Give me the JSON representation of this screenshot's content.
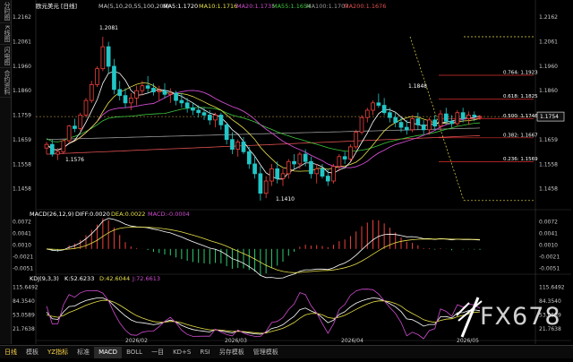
{
  "sidebar": {
    "tabs": [
      {
        "label": "分时图"
      },
      {
        "label": "K线图"
      },
      {
        "label": "闪电图"
      },
      {
        "label": "合约资料"
      }
    ]
  },
  "main_legend": {
    "symbol": "欧元美元",
    "period": "[日线]",
    "ma_params": "MA(5,10,20,55,100,200)",
    "ma5": "MA5:1.1720",
    "ma10": "MA10:1.1716",
    "ma20": "MA20:1.1735",
    "ma55": "MA55:1.1654",
    "ma100": "MA100:1.1707",
    "ma200": "MA200:1.1676"
  },
  "price_axis": {
    "left": [
      "1.2162",
      "1.2061",
      "1.1960",
      "1.1860",
      "1.1759",
      "1.1659",
      "1.1558",
      "1.1458"
    ],
    "right": [
      "1.2162",
      "1.2061",
      "1.1960",
      "1.1860",
      "1.1759",
      "1.1659",
      "1.1558",
      "1.1458"
    ],
    "current_price": "1.1754"
  },
  "annotations": {
    "high": "1.2081",
    "low1": "1.1576",
    "low2": "1.1410",
    "peak": "1.1848"
  },
  "fib_levels": [
    {
      "label": "0.764: 1.1923",
      "value": 1.1923
    },
    {
      "label": "0.618: 1.1825",
      "value": 1.1825
    },
    {
      "label": "0.500: 1.1746",
      "value": 1.1746
    },
    {
      "label": "0.382: 1.1667",
      "value": 1.1667
    },
    {
      "label": "0.236: 1.1569",
      "value": 1.1569
    }
  ],
  "macd_legend": {
    "params": "MACD(26,12,9)",
    "diff": "DIFF:0.0020",
    "dea": "DEA:0.0022",
    "macd": "MACD:-0.0004"
  },
  "macd_axis": {
    "left": [
      "0.0072",
      "0.0041",
      "0.0010",
      "-0.0021",
      "-0.0051"
    ],
    "right": [
      "0.0072",
      "0.0041",
      "0.0010",
      "-0.0021",
      "-0.0051"
    ]
  },
  "kdj_legend": {
    "params": "KDJ(9,3,3)",
    "k": "K:52.6233",
    "d": "D:42.6044",
    "j": "J:72.6613"
  },
  "kdj_axis": {
    "left": [
      "115.6492",
      "84.3540",
      "53.0589",
      "21.7638"
    ],
    "right": [
      "115.6492",
      "84.3540",
      "53.0589",
      "21.7638"
    ]
  },
  "x_axis": {
    "labels": [
      "2026/02",
      "2026/03",
      "2026/04",
      "2026/05"
    ]
  },
  "bottom_tabs": [
    {
      "label": "日线"
    },
    {
      "label": "模板"
    },
    {
      "label": "YZ指标"
    },
    {
      "label": "标准"
    },
    {
      "label": "MACD"
    },
    {
      "label": "BOLL"
    },
    {
      "label": "一目"
    },
    {
      "label": "KD+S"
    },
    {
      "label": "RSI"
    },
    {
      "label": "另存模板"
    },
    {
      "label": "管理模板"
    }
  ],
  "watermark": {
    "text": "FX678"
  },
  "colors": {
    "up": "#f0413c",
    "down": "#22c6c6",
    "ma5": "#ffffff",
    "ma10": "#e8e04a",
    "ma20": "#d04cd0",
    "ma55": "#3dc93d",
    "ma100": "#9a9a9a",
    "ma200": "#e05050",
    "fib": "#e03030",
    "trend": "#e8e04a",
    "background": "#000000",
    "brand": "#ffd54a"
  },
  "chart_data": {
    "type": "candlestick",
    "symbol": "欧元美元",
    "period": "日线",
    "ylim": [
      1.138,
      1.218
    ],
    "x": [
      "2026/01/14",
      "2026/01/15",
      "2026/01/16",
      "2026/01/19",
      "2026/01/20",
      "2026/01/21",
      "2026/01/22",
      "2026/01/23",
      "2026/01/26",
      "2026/01/27",
      "2026/01/28",
      "2026/01/29",
      "2026/01/30",
      "2026/02/02",
      "2026/02/03",
      "2026/02/04",
      "2026/02/05",
      "2026/02/06",
      "2026/02/09",
      "2026/02/10",
      "2026/02/11",
      "2026/02/12",
      "2026/02/13",
      "2026/02/16",
      "2026/02/17",
      "2026/02/18",
      "2026/02/19",
      "2026/02/20",
      "2026/02/23",
      "2026/02/24",
      "2026/02/25",
      "2026/02/26",
      "2026/02/27",
      "2026/03/02",
      "2026/03/03",
      "2026/03/04",
      "2026/03/05",
      "2026/03/06",
      "2026/03/09",
      "2026/03/10",
      "2026/03/11",
      "2026/03/12",
      "2026/03/13",
      "2026/03/16",
      "2026/03/17",
      "2026/03/18",
      "2026/03/19",
      "2026/03/20",
      "2026/03/23",
      "2026/03/24",
      "2026/03/25",
      "2026/03/26",
      "2026/03/27",
      "2026/03/30",
      "2026/03/31",
      "2026/04/01",
      "2026/04/02",
      "2026/04/03",
      "2026/04/06",
      "2026/04/07",
      "2026/04/08",
      "2026/04/09",
      "2026/04/10",
      "2026/04/13",
      "2026/04/14",
      "2026/04/15",
      "2026/04/16",
      "2026/04/17",
      "2026/04/20",
      "2026/04/21",
      "2026/04/22",
      "2026/04/23",
      "2026/04/24",
      "2026/04/27",
      "2026/04/28",
      "2026/04/29",
      "2026/04/30",
      "2026/05/01"
    ],
    "ohlc": [
      [
        1.1625,
        1.165,
        1.16,
        1.164
      ],
      [
        1.164,
        1.166,
        1.159,
        1.16
      ],
      [
        1.16,
        1.1625,
        1.1576,
        1.161
      ],
      [
        1.161,
        1.166,
        1.16,
        1.1655
      ],
      [
        1.1655,
        1.172,
        1.1645,
        1.1715
      ],
      [
        1.1715,
        1.1745,
        1.169,
        1.1705
      ],
      [
        1.1705,
        1.177,
        1.1695,
        1.176
      ],
      [
        1.176,
        1.183,
        1.175,
        1.182
      ],
      [
        1.182,
        1.19,
        1.181,
        1.1885
      ],
      [
        1.1885,
        1.196,
        1.1875,
        1.195
      ],
      [
        1.195,
        1.2081,
        1.194,
        1.204
      ],
      [
        1.204,
        1.206,
        1.193,
        1.196
      ],
      [
        1.196,
        1.199,
        1.1845,
        1.1865
      ],
      [
        1.1865,
        1.19,
        1.182,
        1.184
      ],
      [
        1.184,
        1.187,
        1.179,
        1.181
      ],
      [
        1.181,
        1.185,
        1.178,
        1.183
      ],
      [
        1.183,
        1.188,
        1.18,
        1.186
      ],
      [
        1.186,
        1.19,
        1.184,
        1.188
      ],
      [
        1.188,
        1.192,
        1.185,
        1.187
      ],
      [
        1.187,
        1.189,
        1.184,
        1.1855
      ],
      [
        1.1855,
        1.188,
        1.182,
        1.186
      ],
      [
        1.186,
        1.189,
        1.183,
        1.1845
      ],
      [
        1.1845,
        1.187,
        1.181,
        1.185
      ],
      [
        1.185,
        1.186,
        1.18,
        1.182
      ],
      [
        1.182,
        1.185,
        1.179,
        1.181
      ],
      [
        1.181,
        1.183,
        1.177,
        1.179
      ],
      [
        1.179,
        1.181,
        1.176,
        1.178
      ],
      [
        1.178,
        1.18,
        1.175,
        1.177
      ],
      [
        1.177,
        1.179,
        1.174,
        1.176
      ],
      [
        1.176,
        1.178,
        1.172,
        1.174
      ],
      [
        1.174,
        1.177,
        1.171,
        1.176
      ],
      [
        1.176,
        1.177,
        1.17,
        1.172
      ],
      [
        1.172,
        1.173,
        1.164,
        1.166
      ],
      [
        1.166,
        1.169,
        1.16,
        1.162
      ],
      [
        1.162,
        1.166,
        1.159,
        1.165
      ],
      [
        1.165,
        1.167,
        1.16,
        1.161
      ],
      [
        1.161,
        1.163,
        1.154,
        1.156
      ],
      [
        1.156,
        1.159,
        1.15,
        1.152
      ],
      [
        1.152,
        1.155,
        1.141,
        1.144
      ],
      [
        1.144,
        1.151,
        1.142,
        1.149
      ],
      [
        1.149,
        1.156,
        1.147,
        1.154
      ],
      [
        1.154,
        1.157,
        1.148,
        1.15
      ],
      [
        1.15,
        1.154,
        1.147,
        1.152
      ],
      [
        1.152,
        1.158,
        1.15,
        1.157
      ],
      [
        1.157,
        1.16,
        1.154,
        1.156
      ],
      [
        1.156,
        1.161,
        1.154,
        1.16
      ],
      [
        1.16,
        1.162,
        1.155,
        1.157
      ],
      [
        1.157,
        1.159,
        1.15,
        1.152
      ],
      [
        1.152,
        1.156,
        1.148,
        1.154
      ],
      [
        1.154,
        1.156,
        1.15,
        1.151
      ],
      [
        1.151,
        1.154,
        1.147,
        1.149
      ],
      [
        1.149,
        1.156,
        1.148,
        1.155
      ],
      [
        1.155,
        1.16,
        1.153,
        1.159
      ],
      [
        1.159,
        1.161,
        1.156,
        1.158
      ],
      [
        1.158,
        1.164,
        1.157,
        1.163
      ],
      [
        1.163,
        1.17,
        1.162,
        1.169
      ],
      [
        1.169,
        1.176,
        1.168,
        1.175
      ],
      [
        1.175,
        1.179,
        1.173,
        1.178
      ],
      [
        1.178,
        1.182,
        1.176,
        1.181
      ],
      [
        1.181,
        1.1848,
        1.179,
        1.18
      ],
      [
        1.18,
        1.183,
        1.176,
        1.177
      ],
      [
        1.177,
        1.179,
        1.173,
        1.175
      ],
      [
        1.175,
        1.177,
        1.171,
        1.173
      ],
      [
        1.173,
        1.175,
        1.169,
        1.171
      ],
      [
        1.171,
        1.174,
        1.168,
        1.17
      ],
      [
        1.17,
        1.176,
        1.169,
        1.1745
      ],
      [
        1.1745,
        1.177,
        1.17,
        1.172
      ],
      [
        1.172,
        1.174,
        1.168,
        1.17
      ],
      [
        1.17,
        1.175,
        1.168,
        1.174
      ],
      [
        1.174,
        1.176,
        1.17,
        1.1715
      ],
      [
        1.1715,
        1.178,
        1.17,
        1.1765
      ],
      [
        1.1765,
        1.179,
        1.172,
        1.1735
      ],
      [
        1.1735,
        1.176,
        1.171,
        1.1725
      ],
      [
        1.1725,
        1.178,
        1.1715,
        1.177
      ],
      [
        1.177,
        1.179,
        1.173,
        1.1745
      ],
      [
        1.1745,
        1.1775,
        1.172,
        1.176
      ],
      [
        1.176,
        1.1775,
        1.1735,
        1.1754
      ],
      [
        1.1754,
        1.176,
        1.174,
        1.1754
      ]
    ],
    "macd_ylim": [
      -0.0062,
      0.008
    ],
    "kdj_ylim": [
      0,
      125
    ]
  }
}
